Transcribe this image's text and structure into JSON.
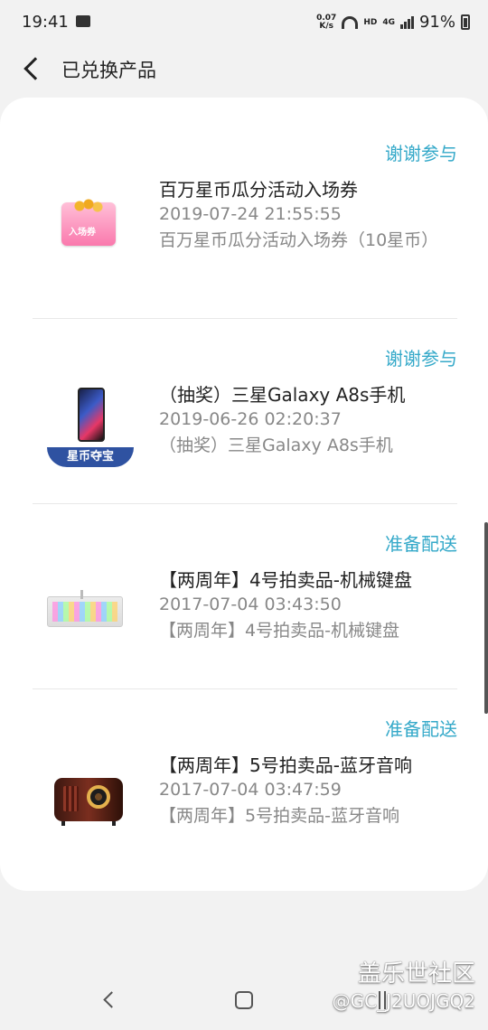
{
  "status_bar": {
    "time": "19:41",
    "network_speed_top": "0.07",
    "network_speed_unit": "K/s",
    "hd": "HD",
    "signal": "4G",
    "battery": "91%"
  },
  "header": {
    "title": "已兑换产品"
  },
  "items": [
    {
      "status": "谢谢参与",
      "name": "百万星币瓜分活动入场券",
      "date": "2019-07-24 21:55:55",
      "description": "百万星币瓜分活动入场券（10星币）",
      "image": "ticket-image",
      "image_label": "入场券"
    },
    {
      "status": "谢谢参与",
      "name": "（抽奖）三星Galaxy A8s手机",
      "date": "2019-06-26 02:20:37",
      "description": "（抽奖）三星Galaxy A8s手机",
      "image": "phone-image",
      "image_label": "星币夺宝"
    },
    {
      "status": "准备配送",
      "name": "【两周年】4号拍卖品-机械键盘",
      "date": "2017-07-04 03:43:50",
      "description": "【两周年】4号拍卖品-机械键盘",
      "image": "keyboard-image"
    },
    {
      "status": "准备配送",
      "name": "【两周年】5号拍卖品-蓝牙音响",
      "date": "2017-07-04 03:47:59",
      "description": "【两周年】5号拍卖品-蓝牙音响",
      "image": "speaker-image"
    }
  ],
  "watermark": {
    "main": "盖乐世社区",
    "sub": "@GC_J2UOJGQ2"
  },
  "colors": {
    "status_blue": "#35a9c9",
    "background": "#f2f2f2",
    "card": "#ffffff"
  }
}
